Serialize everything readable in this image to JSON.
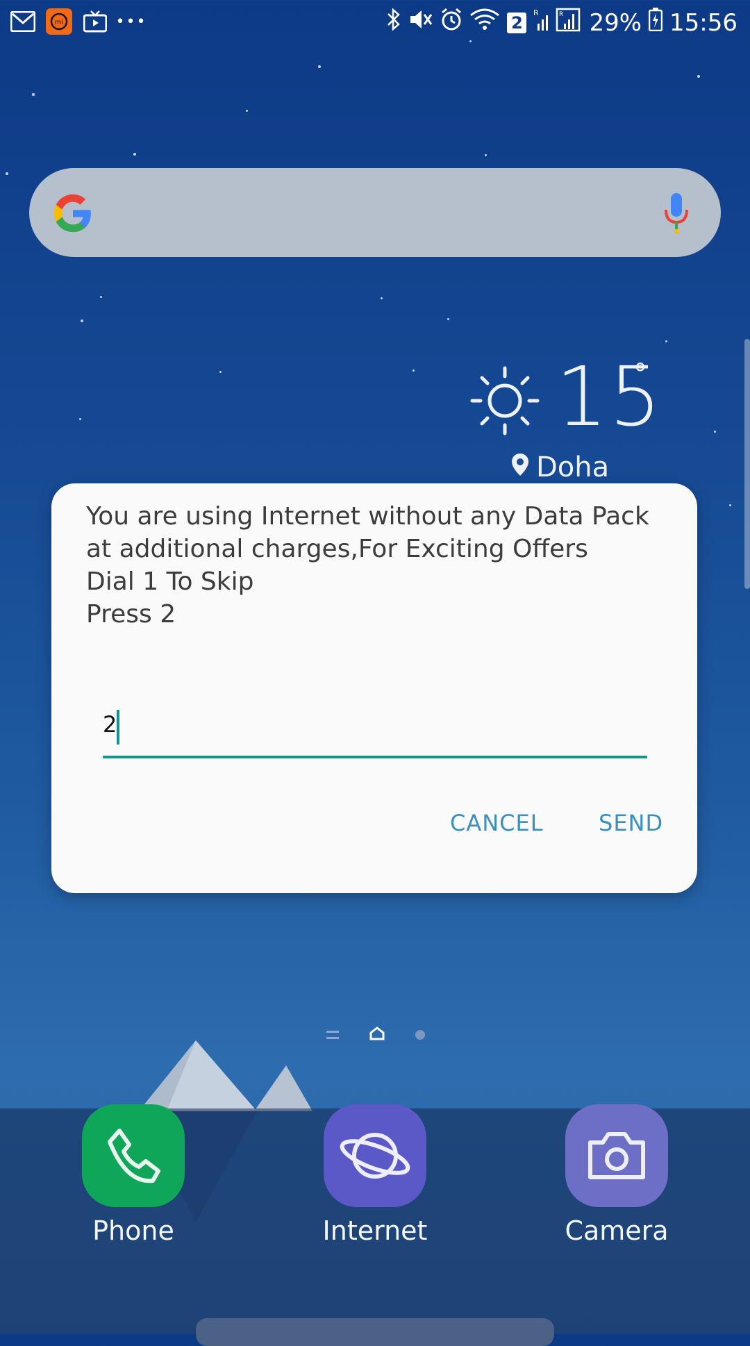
{
  "status_bar": {
    "left_icons": [
      "gmail-icon",
      "mi-icon",
      "tv-icon",
      "more-icon"
    ],
    "more_label": "•••",
    "network_badge": "2",
    "battery_percent": "29%",
    "time": "15:56"
  },
  "search_bar": {
    "logo": "google-logo-icon",
    "mic": "mic-icon"
  },
  "weather": {
    "temperature": "15",
    "degree_symbol": "°",
    "location": "Doha",
    "icon": "sun-icon"
  },
  "dialog": {
    "message_lines": [
      "You are using Internet without any Data Pack",
      "at additional charges,For Exciting Offers",
      "Dial 1 To Skip",
      "Press 2"
    ],
    "input_value": "2",
    "cancel_label": "CANCEL",
    "send_label": "SEND",
    "accent_color": "#15968a",
    "button_color": "#3a8fbf"
  },
  "dock": {
    "apps": [
      {
        "label": "Phone",
        "icon": "phone-icon",
        "color": "#0fa65a"
      },
      {
        "label": "Internet",
        "icon": "internet-planet-icon",
        "color": "#5b59c8"
      },
      {
        "label": "Camera",
        "icon": "camera-icon",
        "color": "#6d6fc7"
      }
    ]
  }
}
